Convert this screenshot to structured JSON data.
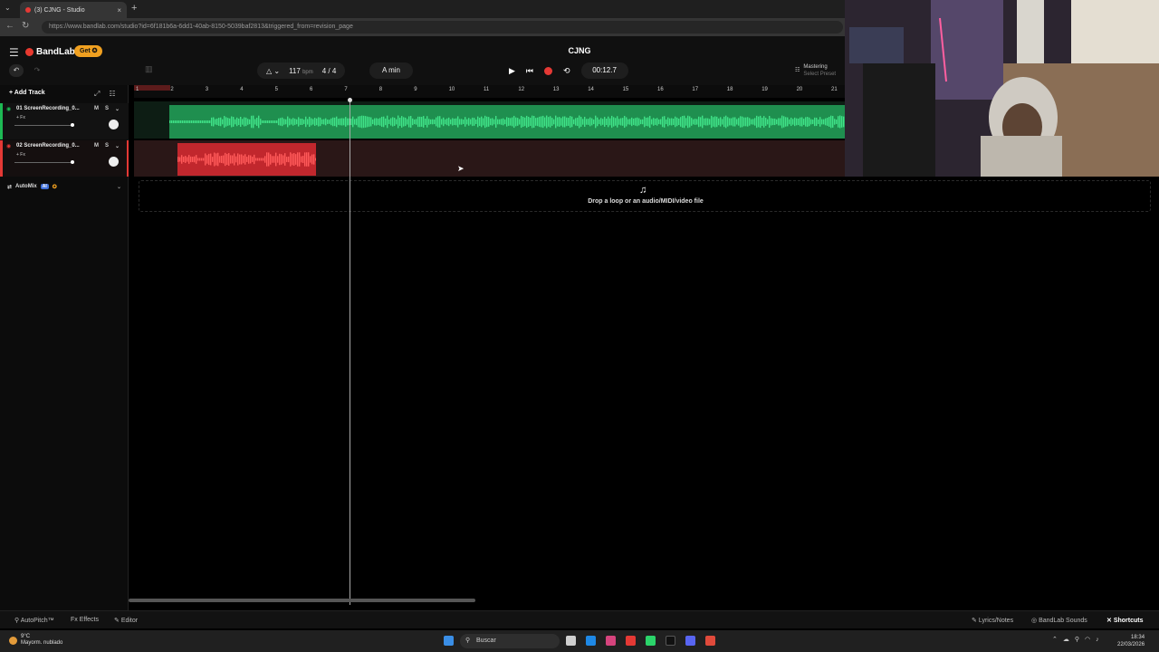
{
  "browser": {
    "tab_title": "(3) CJNG - Studio",
    "close_glyph": "×",
    "new_tab_glyph": "+",
    "url": "https://www.bandlab.com/studio?id=6f181b6a-6dd1-40ab-8150-5039baf2813&triggered_from=revision_page"
  },
  "app": {
    "brand": "BandLab",
    "get_label": "Get ✪",
    "project_title": "CJNG",
    "tempo": "117",
    "tempo_unit": "bpm",
    "time_signature": "4 / 4",
    "key": "A min",
    "time": "00:12.7",
    "mastering_label": "Mastering",
    "mastering_sub": "Select Preset",
    "add_track_label": "+ Add Track"
  },
  "ruler": {
    "marks": [
      "1",
      "2",
      "3",
      "4",
      "5",
      "6",
      "7",
      "8",
      "9",
      "10",
      "11",
      "12",
      "13",
      "14",
      "15",
      "16",
      "17",
      "18",
      "19",
      "20",
      "21"
    ]
  },
  "tracks": [
    {
      "name": "01  ScreenRecording_0...",
      "fx": "+ Fx",
      "mute": "M",
      "solo": "S",
      "color": "#1db954"
    },
    {
      "name": "02  ScreenRecording_0...",
      "fx": "+ Fx",
      "mute": "M",
      "solo": "S",
      "color": "#e53935"
    }
  ],
  "automix": {
    "label": "AutoMix",
    "ai_badge": "AI"
  },
  "drop_zone": {
    "text": "Drop a loop or an audio/MIDI/video file"
  },
  "bottom": {
    "autopitch": "AutoPitch™",
    "effects": "Effects",
    "editor": "Editor",
    "lyrics": "Lyrics/Notes",
    "sounds": "BandLab Sounds",
    "shortcuts": "Shortcuts"
  },
  "taskbar": {
    "weather_temp": "9°C",
    "weather_desc": "Mayorm. nublado",
    "search": "Buscar",
    "time": "18:34",
    "date": "22/03/2026"
  },
  "colors": {
    "accent_green": "#1db954",
    "accent_red": "#e53935",
    "get_badge": "#f0a020"
  }
}
